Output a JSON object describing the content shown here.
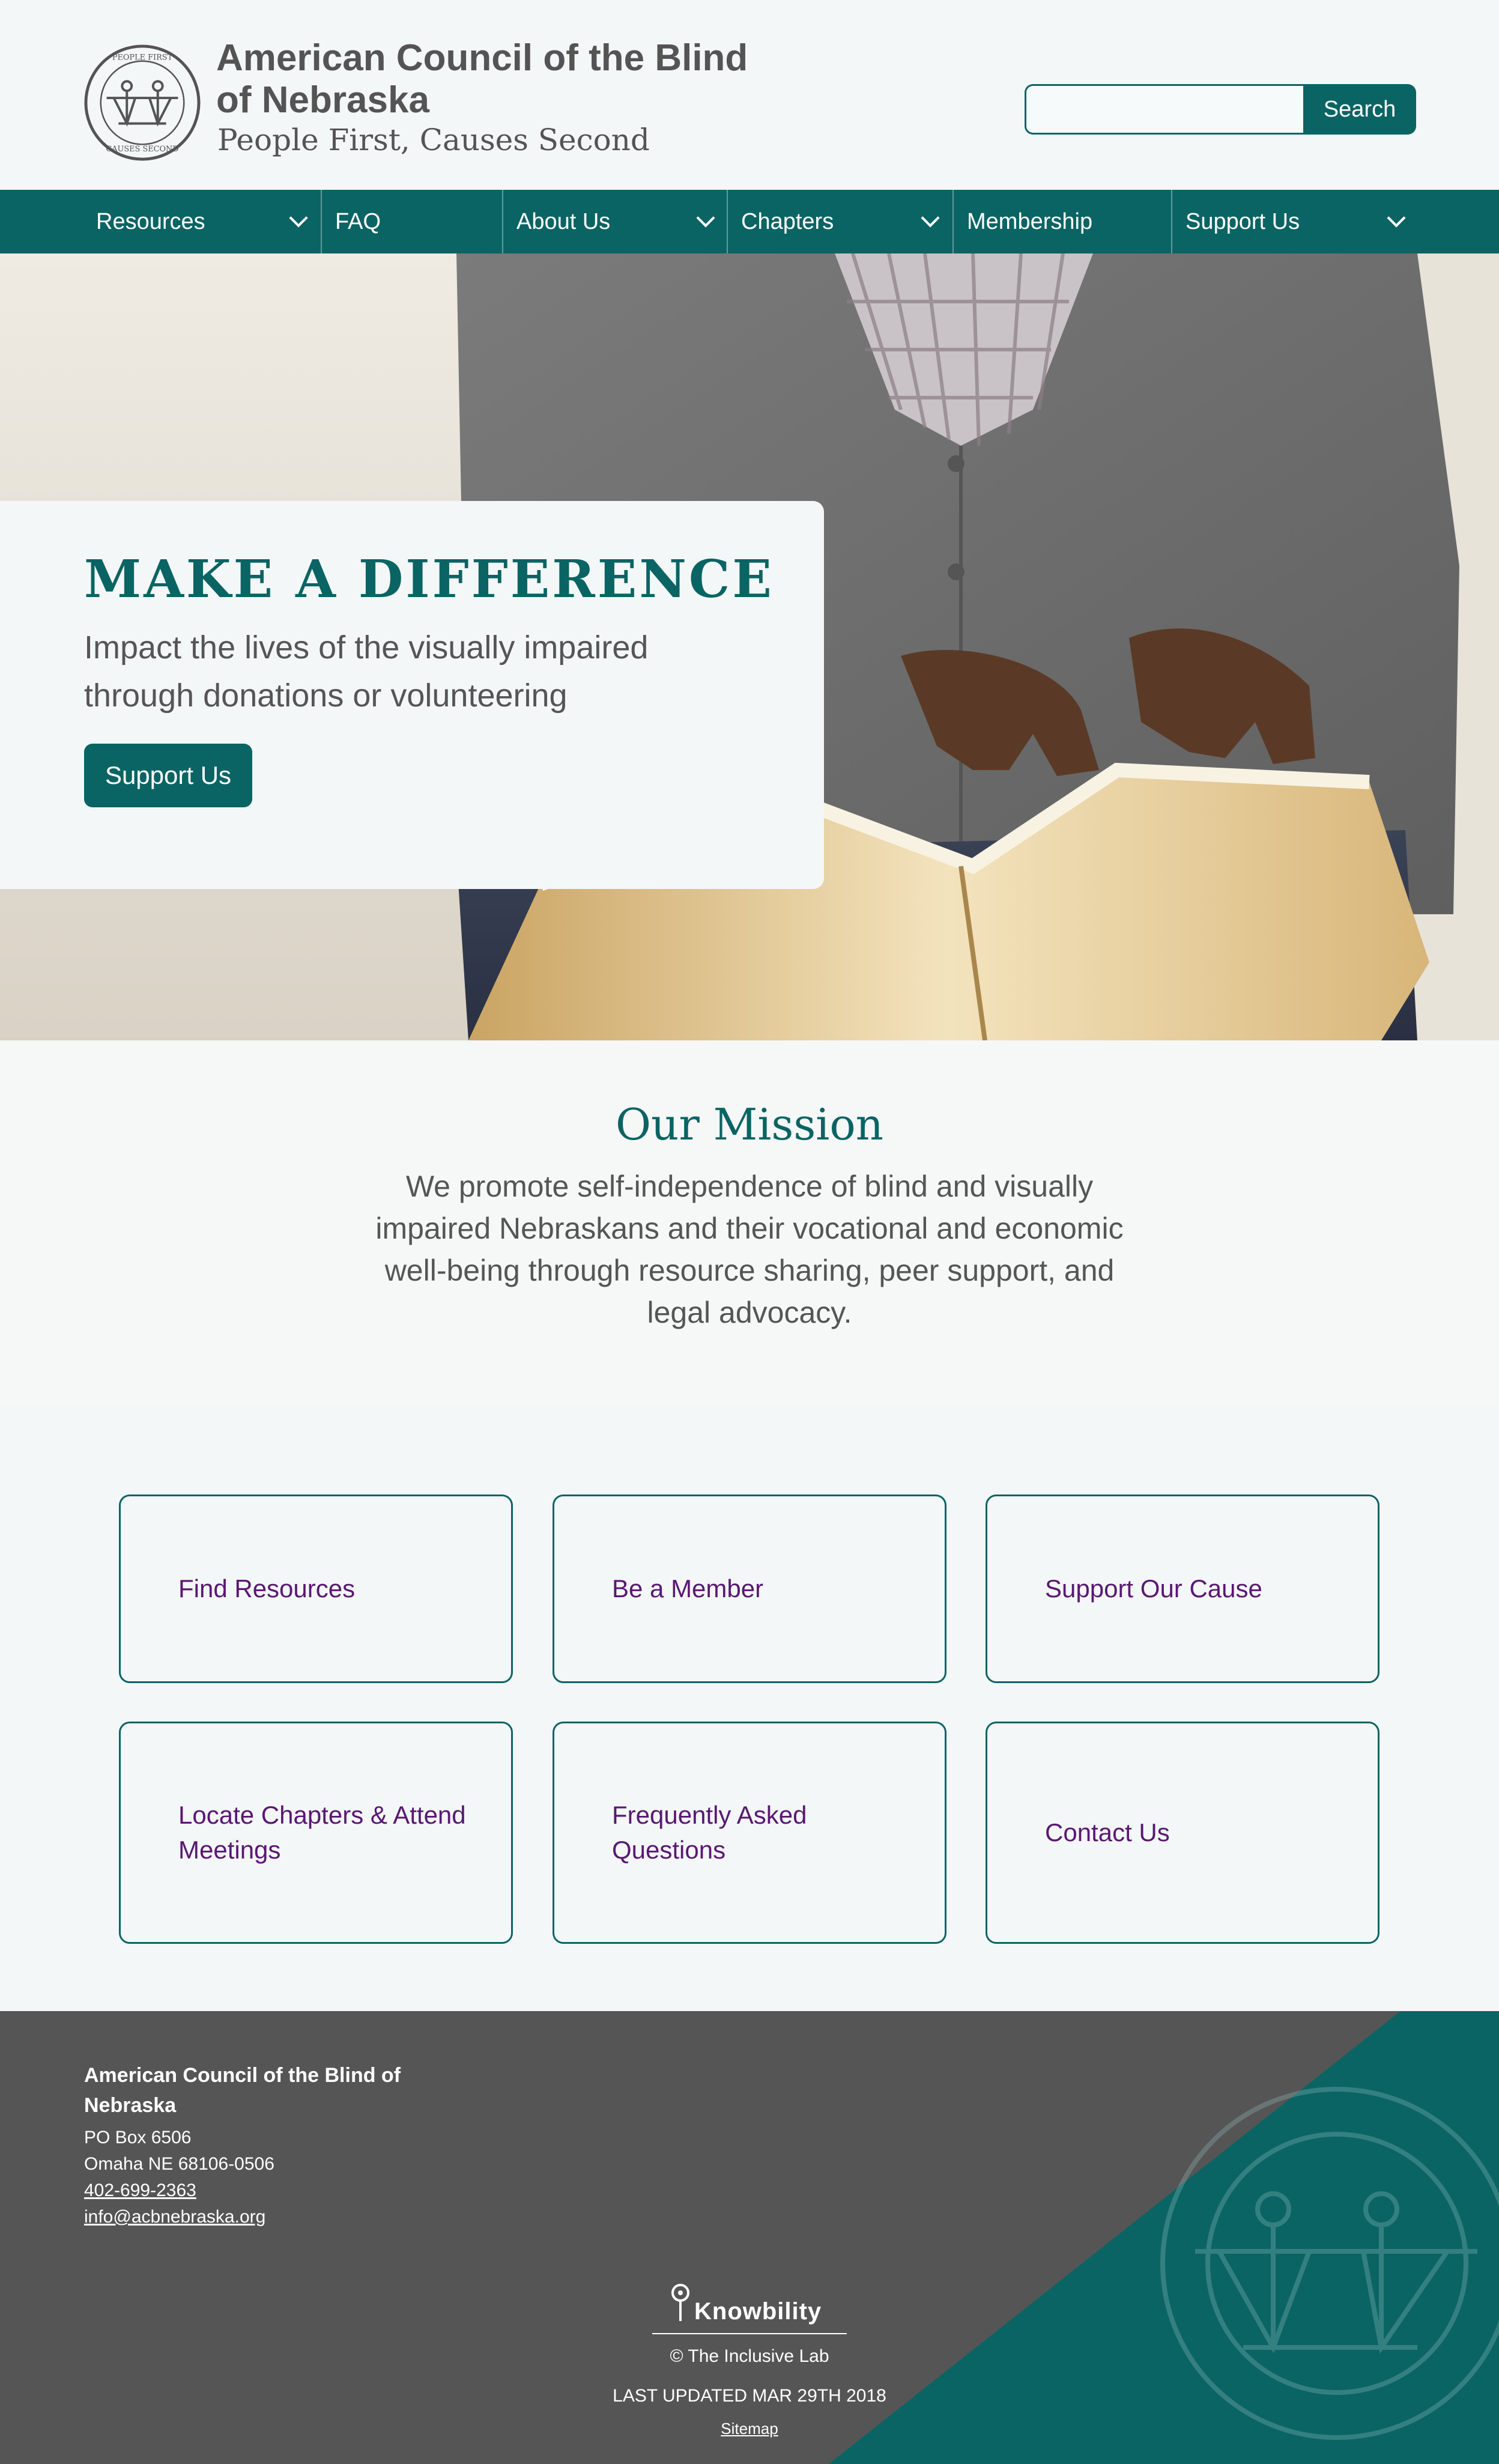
{
  "header": {
    "org_name": "American Council of the Blind of Nebraska",
    "tagline": "People First, Causes Second",
    "logo_text_top": "PEOPLE FIRST",
    "logo_text_bottom": "CAUSES SECOND",
    "search_placeholder": "",
    "search_button": "Search"
  },
  "nav": {
    "items": [
      {
        "label": "Resources",
        "has_dropdown": true
      },
      {
        "label": "FAQ",
        "has_dropdown": false
      },
      {
        "label": "About Us",
        "has_dropdown": true
      },
      {
        "label": "Chapters",
        "has_dropdown": true
      },
      {
        "label": "Membership",
        "has_dropdown": false
      },
      {
        "label": "Support Us",
        "has_dropdown": true
      }
    ]
  },
  "hero": {
    "heading": "MAKE A DIFFERENCE",
    "subtext": "Impact the lives of the visually impaired through donations or volunteering",
    "button": "Support Us"
  },
  "mission": {
    "title": "Our Mission",
    "text": "We promote self-independence of blind and visually impaired Nebraskans and their vocational and economic well-being through resource sharing, peer support, and legal advocacy."
  },
  "cards": [
    {
      "label": "Find Resources"
    },
    {
      "label": "Be a Member"
    },
    {
      "label": "Support Our Cause"
    },
    {
      "label": "Locate Chapters & Attend Meetings"
    },
    {
      "label": "Frequently Asked Questions"
    },
    {
      "label": "Contact Us"
    }
  ],
  "footer": {
    "org_name": "American Council of the Blind of Nebraska",
    "po_box": "PO Box 6506",
    "city": "Omaha NE 68106-0506",
    "phone": "402-699-2363",
    "email": "info@acbnebraska.org",
    "partner": "Knowbility",
    "copyright": "© The Inclusive Lab",
    "last_updated": "LAST UPDATED MAR 29TH 2018",
    "sitemap": "Sitemap"
  },
  "colors": {
    "brand": "#0b6464",
    "link": "#5a1772",
    "footer_bg": "#555555"
  }
}
